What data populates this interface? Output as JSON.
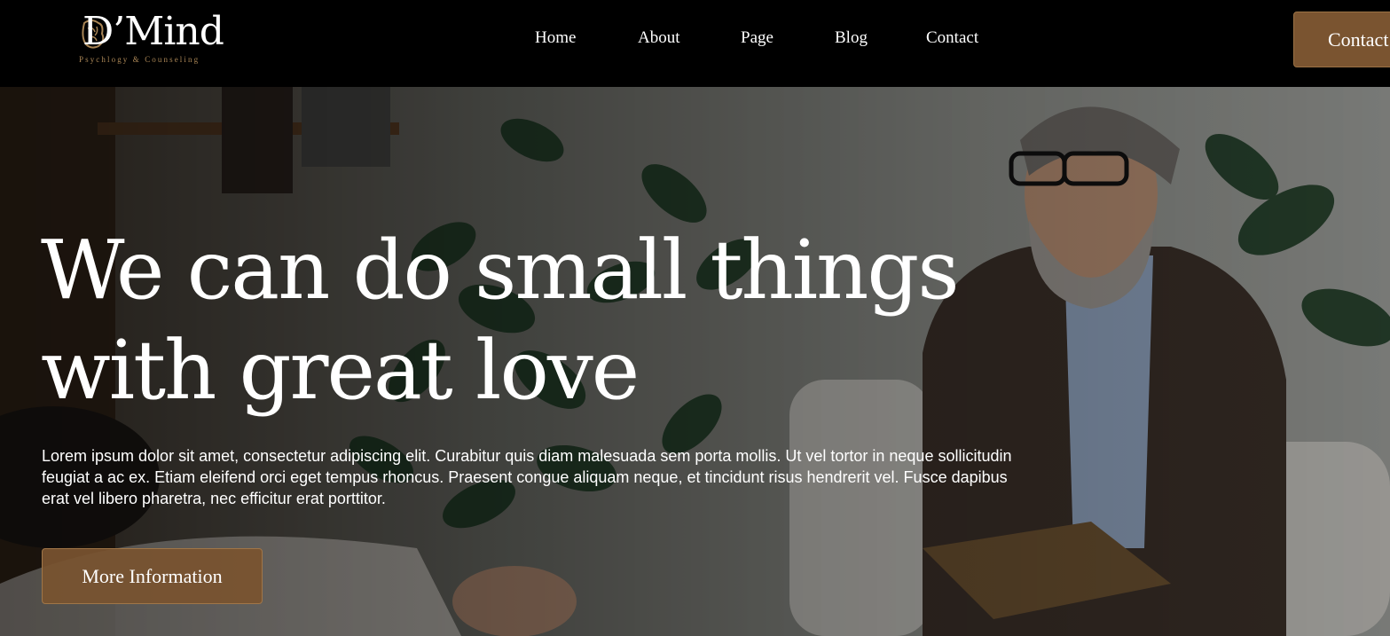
{
  "brand": {
    "name": "D’Mind",
    "tagline": "Psychlogy & Counseling",
    "logo_icon": "brain-icon",
    "accent_color": "#7a5430"
  },
  "nav": {
    "items": [
      {
        "label": "Home"
      },
      {
        "label": "About"
      },
      {
        "label": "Page"
      },
      {
        "label": "Blog"
      },
      {
        "label": "Contact"
      }
    ],
    "cta_label": "Contact"
  },
  "hero": {
    "title_line_1": "We can do small things",
    "title_line_2": "with great love",
    "description": "Lorem ipsum dolor sit amet, consectetur adipiscing elit. Curabitur quis diam malesuada sem porta mollis. Ut vel tortor in neque sollicitudin feugiat a ac ex. Etiam eleifend orci eget tempus rhoncus. Praesent congue aliquam neque, et tincidunt risus hendrerit vel. Fusce dapibus erat vel libero pharetra, nec efficitur erat porttitor.",
    "button_label": "More Information"
  }
}
